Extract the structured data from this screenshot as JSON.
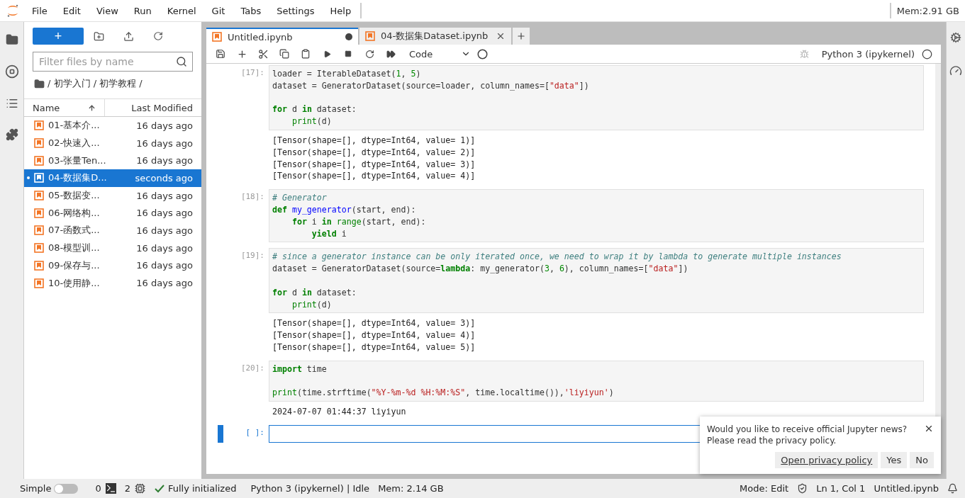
{
  "menu": [
    "File",
    "Edit",
    "View",
    "Run",
    "Kernel",
    "Git",
    "Tabs",
    "Settings",
    "Help"
  ],
  "memory_top": "Mem:2.91 GB",
  "file_browser": {
    "new_label": "+",
    "filter_placeholder": "Filter files by name",
    "breadcrumb": [
      "/ 初学入门 / 初学教程 /"
    ],
    "columns": [
      {
        "label": "Name",
        "sorted": true
      },
      {
        "label": "Last Modified",
        "sorted": false
      }
    ],
    "files": [
      {
        "name": "01-基本介...",
        "modified": "16 days ago",
        "selected": false,
        "running": false
      },
      {
        "name": "02-快速入...",
        "modified": "16 days ago",
        "selected": false,
        "running": false
      },
      {
        "name": "03-张量Ten...",
        "modified": "16 days ago",
        "selected": false,
        "running": false
      },
      {
        "name": "04-数据集D...",
        "modified": "seconds ago",
        "selected": true,
        "running": true
      },
      {
        "name": "05-数据变...",
        "modified": "16 days ago",
        "selected": false,
        "running": false
      },
      {
        "name": "06-网络构...",
        "modified": "16 days ago",
        "selected": false,
        "running": false
      },
      {
        "name": "07-函数式...",
        "modified": "16 days ago",
        "selected": false,
        "running": false
      },
      {
        "name": "08-模型训...",
        "modified": "16 days ago",
        "selected": false,
        "running": false
      },
      {
        "name": "09-保存与...",
        "modified": "16 days ago",
        "selected": false,
        "running": false
      },
      {
        "name": "10-使用静...",
        "modified": "16 days ago",
        "selected": false,
        "running": false
      }
    ]
  },
  "tabs": [
    {
      "label": "Untitled.ipynb",
      "selected": true,
      "dirty": true
    },
    {
      "label": "04-数据集Dataset.ipynb",
      "selected": false,
      "dirty": false
    }
  ],
  "toolbar": {
    "cell_type": "Code",
    "kernel": "Python 3 (ipykernel)"
  },
  "cells": [
    {
      "prompt": "[17]:",
      "active": false,
      "lines": [
        {
          "spaced": false,
          "segments": [
            {
              "text": "loader = IterableDataset(",
              "kind": "plain"
            },
            {
              "text": "1",
              "kind": "num"
            },
            {
              "text": ", ",
              "kind": "plain"
            },
            {
              "text": "5",
              "kind": "num"
            },
            {
              "text": ")",
              "kind": "plain"
            }
          ]
        },
        {
          "spaced": false,
          "segments": [
            {
              "text": "dataset = GeneratorDataset(source=loader, column_names=[",
              "kind": "plain"
            },
            {
              "text": "\"data\"",
              "kind": "str"
            },
            {
              "text": "])",
              "kind": "plain"
            }
          ]
        },
        {
          "spaced": true,
          "segments": [
            {
              "text": "for",
              "kind": "kw"
            },
            {
              "text": " d ",
              "kind": "plain"
            },
            {
              "text": "in",
              "kind": "kw"
            },
            {
              "text": " dataset:",
              "kind": "plain"
            }
          ]
        },
        {
          "spaced": false,
          "segments": [
            {
              "text": "    print",
              "kind": "builtin"
            },
            {
              "text": "(d)",
              "kind": "plain"
            }
          ]
        }
      ],
      "output": [
        "[Tensor(shape=[], dtype=Int64, value= 1)]",
        "[Tensor(shape=[], dtype=Int64, value= 2)]",
        "[Tensor(shape=[], dtype=Int64, value= 3)]",
        "[Tensor(shape=[], dtype=Int64, value= 4)]"
      ]
    },
    {
      "prompt": "[18]:",
      "active": false,
      "lines": [
        {
          "spaced": false,
          "segments": [
            {
              "text": "# Generator",
              "kind": "comment"
            }
          ]
        },
        {
          "spaced": false,
          "segments": [
            {
              "text": "def",
              "kind": "kw"
            },
            {
              "text": " my_generator",
              "kind": "fn"
            },
            {
              "text": "(start, end):",
              "kind": "plain"
            }
          ]
        },
        {
          "spaced": false,
          "segments": [
            {
              "text": "    for",
              "kind": "kw"
            },
            {
              "text": " i ",
              "kind": "plain"
            },
            {
              "text": "in",
              "kind": "kw"
            },
            {
              "text": " range",
              "kind": "builtin"
            },
            {
              "text": "(start, end):",
              "kind": "plain"
            }
          ]
        },
        {
          "spaced": false,
          "segments": [
            {
              "text": "        yield",
              "kind": "kw"
            },
            {
              "text": " i",
              "kind": "plain"
            }
          ]
        }
      ]
    },
    {
      "prompt": "[19]:",
      "active": false,
      "lines": [
        {
          "spaced": false,
          "segments": [
            {
              "text": "# since a generator instance can be only iterated once, we need to wrap it by lambda to generate multiple instances",
              "kind": "comment"
            }
          ]
        },
        {
          "spaced": false,
          "segments": [
            {
              "text": "dataset = GeneratorDataset(source=",
              "kind": "plain"
            },
            {
              "text": "lambda",
              "kind": "kw"
            },
            {
              "text": ": my_generator(",
              "kind": "plain"
            },
            {
              "text": "3",
              "kind": "num"
            },
            {
              "text": ", ",
              "kind": "plain"
            },
            {
              "text": "6",
              "kind": "num"
            },
            {
              "text": "), column_names=[",
              "kind": "plain"
            },
            {
              "text": "\"data\"",
              "kind": "str"
            },
            {
              "text": "])",
              "kind": "plain"
            }
          ]
        },
        {
          "spaced": true,
          "segments": [
            {
              "text": "for",
              "kind": "kw"
            },
            {
              "text": " d ",
              "kind": "plain"
            },
            {
              "text": "in",
              "kind": "kw"
            },
            {
              "text": " dataset:",
              "kind": "plain"
            }
          ]
        },
        {
          "spaced": false,
          "segments": [
            {
              "text": "    print",
              "kind": "builtin"
            },
            {
              "text": "(d)",
              "kind": "plain"
            }
          ]
        }
      ],
      "output": [
        "[Tensor(shape=[], dtype=Int64, value= 3)]",
        "[Tensor(shape=[], dtype=Int64, value= 4)]",
        "[Tensor(shape=[], dtype=Int64, value= 5)]"
      ]
    },
    {
      "prompt": "[20]:",
      "active": false,
      "lines": [
        {
          "spaced": false,
          "segments": [
            {
              "text": "import",
              "kind": "kw"
            },
            {
              "text": " time",
              "kind": "plain"
            }
          ]
        },
        {
          "spaced": true,
          "segments": [
            {
              "text": "print",
              "kind": "builtin"
            },
            {
              "text": "(time.strftime(",
              "kind": "plain"
            },
            {
              "text": "\"%Y-%m-%d %H:%M:%S\"",
              "kind": "str"
            },
            {
              "text": ", time.localtime()),",
              "kind": "plain"
            },
            {
              "text": "'liyiyun'",
              "kind": "str"
            },
            {
              "text": ")",
              "kind": "plain"
            }
          ]
        }
      ],
      "output": [
        "2024-07-07 01:44:37 liyiyun"
      ]
    },
    {
      "prompt": "[ ]:",
      "active": true
    }
  ],
  "notification": {
    "message": "Would you like to receive official Jupyter news?\nPlease read the privacy policy.",
    "link": "Open privacy policy",
    "buttons": [
      "Yes",
      "No"
    ]
  },
  "status_bar": {
    "mode_label": "Simple",
    "simple_mode": false,
    "terminals": "0",
    "kernels": "2",
    "init": "Fully initialized",
    "kernel_status": "Python 3 (ipykernel) | Idle",
    "memory": "Mem: 2.14 GB",
    "edit_mode": "Mode: Edit",
    "cursor": "Ln 1, Col 1",
    "file": "Untitled.ipynb"
  }
}
